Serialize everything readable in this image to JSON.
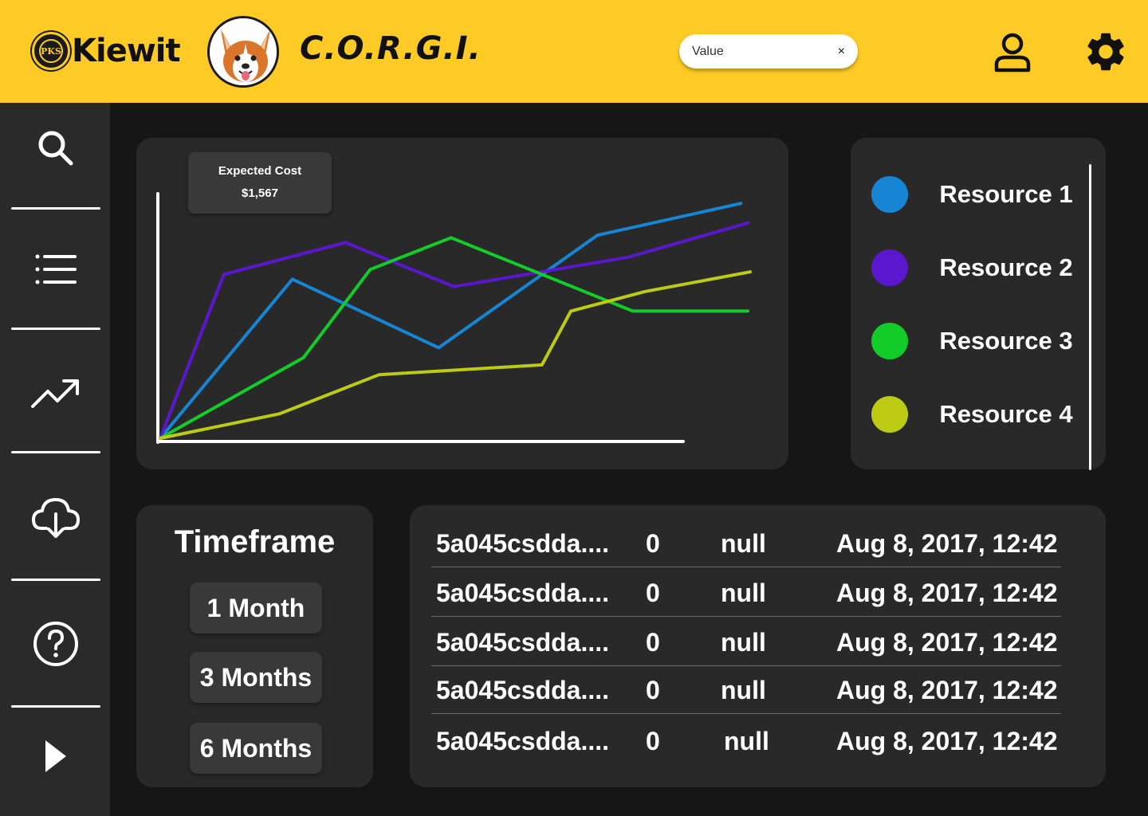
{
  "header": {
    "logo_text": "Kiewit",
    "logo_seal_text": "PKS",
    "app_title": "C.O.R.G.I.",
    "search": {
      "value": "Value",
      "clear_label": "×"
    },
    "bg_color": "#FECB26"
  },
  "sidebar": {
    "items": [
      {
        "icon": "search-icon"
      },
      {
        "icon": "list-icon"
      },
      {
        "icon": "trending-up-icon"
      },
      {
        "icon": "cloud-download-icon"
      },
      {
        "icon": "help-icon"
      },
      {
        "icon": "play-icon"
      }
    ]
  },
  "tooltip": {
    "label": "Expected Cost",
    "value": "$1,567"
  },
  "chart_data": {
    "type": "line",
    "title": "",
    "xlabel": "",
    "ylabel": "",
    "xlim": [
      0,
      100
    ],
    "ylim": [
      0,
      100
    ],
    "grid": false,
    "legend_position": "right",
    "series": [
      {
        "name": "Resource 1",
        "color": "#1686D4",
        "points": [
          [
            0,
            0
          ],
          [
            22.4,
            65
          ],
          [
            47.2,
            37
          ],
          [
            74.1,
            83
          ],
          [
            98.4,
            96
          ]
        ]
      },
      {
        "name": "Resource 2",
        "color": "#5B17CE",
        "points": [
          [
            0,
            0
          ],
          [
            10.8,
            67
          ],
          [
            31.4,
            80
          ],
          [
            49.8,
            62
          ],
          [
            79.3,
            74
          ],
          [
            99.6,
            88
          ]
        ]
      },
      {
        "name": "Resource 3",
        "color": "#13CC2A",
        "points": [
          [
            0,
            0
          ],
          [
            24.3,
            33
          ],
          [
            35.6,
            69
          ],
          [
            49.3,
            82
          ],
          [
            80.1,
            52
          ],
          [
            99.6,
            52
          ]
        ]
      },
      {
        "name": "Resource 4",
        "color": "#BECB14",
        "points": [
          [
            0,
            0
          ],
          [
            20.2,
            10
          ],
          [
            37.1,
            26
          ],
          [
            64.7,
            30
          ],
          [
            69.6,
            52
          ],
          [
            82.2,
            60
          ],
          [
            100,
            68
          ]
        ]
      }
    ]
  },
  "timeframe": {
    "title": "Timeframe",
    "options": [
      "1 Month",
      "3 Months",
      "6 Months"
    ]
  },
  "table": {
    "rows": [
      [
        "5a045csdda....",
        "0",
        "null",
        "Aug 8, 2017, 12:42"
      ],
      [
        "5a045csdda....",
        "0",
        "null",
        "Aug 8, 2017, 12:42"
      ],
      [
        "5a045csdda....",
        "0",
        "null",
        "Aug 8, 2017, 12:42"
      ],
      [
        "5a045csdda....",
        "0",
        "null",
        "Aug 8, 2017, 12:42"
      ],
      [
        "5a045csdda....",
        "0",
        "null",
        "Aug 8, 2017, 12:42"
      ]
    ]
  }
}
